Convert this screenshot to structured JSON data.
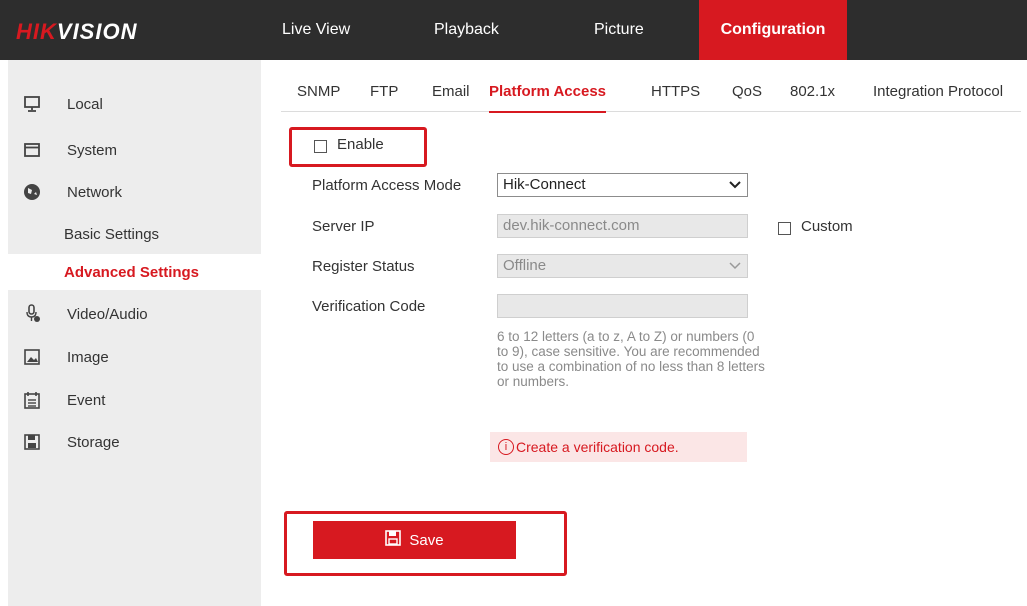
{
  "brand": {
    "logo_red": "HIK",
    "logo_white": "VISION"
  },
  "nav": {
    "tabs": [
      {
        "label": "Live View"
      },
      {
        "label": "Playback"
      },
      {
        "label": "Picture"
      },
      {
        "label": "Configuration",
        "active": true
      }
    ]
  },
  "sidebar": {
    "items": [
      {
        "label": "Local",
        "icon": "monitor-icon"
      },
      {
        "label": "System",
        "icon": "window-icon"
      },
      {
        "label": "Network",
        "icon": "globe-icon"
      },
      {
        "label": "Basic Settings"
      },
      {
        "label": "Advanced Settings",
        "active": true
      },
      {
        "label": "Video/Audio",
        "icon": "microphone-icon"
      },
      {
        "label": "Image",
        "icon": "image-icon"
      },
      {
        "label": "Event",
        "icon": "calendar-icon"
      },
      {
        "label": "Storage",
        "icon": "floppy-icon"
      }
    ]
  },
  "subtabs": [
    {
      "label": "SNMP"
    },
    {
      "label": "FTP"
    },
    {
      "label": "Email"
    },
    {
      "label": "Platform Access",
      "active": true
    },
    {
      "label": "HTTPS"
    },
    {
      "label": "QoS"
    },
    {
      "label": "802.1x"
    },
    {
      "label": "Integration Protocol"
    }
  ],
  "form": {
    "enable_label": "Enable",
    "enable_checked": false,
    "mode_label": "Platform Access Mode",
    "mode_value": "Hik-Connect",
    "server_ip_label": "Server IP",
    "server_ip_value": "dev.hik-connect.com",
    "custom_label": "Custom",
    "register_status_label": "Register Status",
    "register_status_value": "Offline",
    "verification_label": "Verification Code",
    "verification_value": "",
    "hint": "6 to 12 letters (a to z, A to Z) or numbers (0 to 9), case sensitive. You are recommended to use a combination of no less than 8 letters or numbers.",
    "alert": "Create a verification code.",
    "save_label": "Save"
  },
  "colors": {
    "accent": "#d71920",
    "topbar": "#2d2d2d",
    "sidebar": "#ededed"
  }
}
